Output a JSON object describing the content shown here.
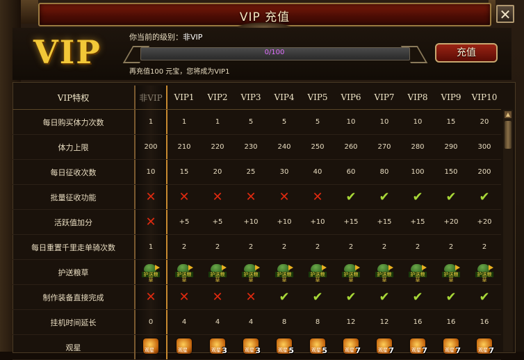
{
  "window": {
    "title": "VIP 充值",
    "close_label": "✕"
  },
  "header": {
    "vip_logo": "VIP",
    "current_level_label": "你当前的级别：",
    "current_level_value": "非VIP",
    "progress_text": "0/100",
    "progress_fraction": 0,
    "hint": "再充值100 元宝，您将成为VIP1",
    "charge_button": "充值"
  },
  "table": {
    "columns": [
      "VIP特权",
      "非VIP",
      "VIP1",
      "VIP2",
      "VIP3",
      "VIP4",
      "VIP5",
      "VIP6",
      "VIP7",
      "VIP8",
      "VIP9",
      "VIP10"
    ],
    "rows": [
      {
        "label": "每日购买体力次数",
        "type": "text",
        "values": [
          "1",
          "1",
          "1",
          "5",
          "5",
          "5",
          "10",
          "10",
          "10",
          "15",
          "20"
        ]
      },
      {
        "label": "体力上限",
        "type": "text",
        "values": [
          "200",
          "210",
          "220",
          "230",
          "240",
          "250",
          "260",
          "270",
          "280",
          "290",
          "300"
        ]
      },
      {
        "label": "每日征收次数",
        "type": "text",
        "values": [
          "10",
          "15",
          "20",
          "25",
          "30",
          "40",
          "60",
          "80",
          "100",
          "150",
          "200"
        ]
      },
      {
        "label": "批量征收功能",
        "type": "bool",
        "values": [
          false,
          false,
          false,
          false,
          false,
          false,
          true,
          true,
          true,
          true,
          true
        ]
      },
      {
        "label": "活跃值加分",
        "type": "mixed",
        "values": [
          false,
          "+5",
          "+5",
          "+10",
          "+10",
          "+10",
          "+15",
          "+15",
          "+15",
          "+20",
          "+20"
        ]
      },
      {
        "label": "每日重置千里走单骑次数",
        "type": "text",
        "values": [
          "1",
          "2",
          "2",
          "2",
          "2",
          "2",
          "2",
          "2",
          "2",
          "2",
          "2"
        ]
      },
      {
        "label": "护送粮草",
        "type": "cart",
        "values": [
          "护送粮草",
          "护送粮草",
          "护送粮草",
          "护送粮草",
          "护送粮草",
          "护送粮草",
          "护送粮草",
          "护送粮草",
          "护送粮草",
          "护送粮草",
          "护送粮草"
        ]
      },
      {
        "label": "制作装备直接完成",
        "type": "bool",
        "values": [
          false,
          false,
          false,
          false,
          true,
          true,
          true,
          true,
          true,
          true,
          true
        ]
      },
      {
        "label": "挂机时间延长",
        "type": "text",
        "values": [
          "0",
          "4",
          "4",
          "4",
          "8",
          "8",
          "12",
          "12",
          "16",
          "16",
          "16"
        ]
      },
      {
        "label": "观星",
        "type": "star",
        "values": [
          "",
          "",
          "3",
          "3",
          "5",
          "5",
          "7",
          "7",
          "7",
          "7",
          "7"
        ]
      }
    ],
    "star_caption": "观星"
  },
  "colors": {
    "cross": "#e02a10",
    "check": "#a8d838",
    "gold": "#f2c838",
    "progress_text": "#e070ff"
  },
  "icons": {
    "cross": "cross-icon",
    "check": "check-icon",
    "cart": "grain-cart-icon",
    "star": "star-gazing-icon"
  }
}
